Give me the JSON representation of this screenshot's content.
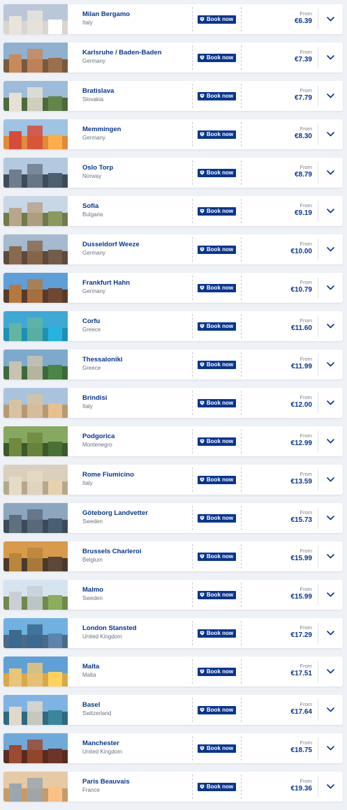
{
  "book_label": "Book now",
  "from_label": "From",
  "colors": {
    "brand": "#073590",
    "accent": "#f1c933",
    "card": "#ffffff",
    "background": "#eef1f6"
  },
  "destinations": [
    {
      "city": "Milan Bergamo",
      "country": "Italy",
      "price": "€6.39",
      "sky": "#b9c7d8",
      "ground": "#d9d6cf",
      "build": "#e8e4dc"
    },
    {
      "city": "Karlsruhe / Baden-Baden",
      "country": "Germany",
      "price": "€7.39",
      "sky": "#8fb0cf",
      "ground": "#7a5a3c",
      "build": "#c98a5a"
    },
    {
      "city": "Bratislava",
      "country": "Slovakia",
      "price": "€7.79",
      "sky": "#9dbcd9",
      "ground": "#4f6a3a",
      "build": "#e6e1d4"
    },
    {
      "city": "Memmingen",
      "country": "Germany",
      "price": "€8.30",
      "sky": "#9ec4e3",
      "ground": "#e08a3a",
      "build": "#d64b3a"
    },
    {
      "city": "Oslo Torp",
      "country": "Norway",
      "price": "€8.79",
      "sky": "#b3c9df",
      "ground": "#3c4c5a",
      "build": "#6e7e8e"
    },
    {
      "city": "Sofia",
      "country": "Bulgaria",
      "price": "€9.19",
      "sky": "#c7d7e6",
      "ground": "#6f7b4a",
      "build": "#b8a58a"
    },
    {
      "city": "Dusseldorf Weeze",
      "country": "Germany",
      "price": "€10.00",
      "sky": "#a5b9cf",
      "ground": "#5c4a3a",
      "build": "#8a6a4e"
    },
    {
      "city": "Frankfurt Hahn",
      "country": "Germany",
      "price": "€10.79",
      "sky": "#5f9fd9",
      "ground": "#5a3a28",
      "build": "#b5793f"
    },
    {
      "city": "Corfu",
      "country": "Greece",
      "price": "€11.60",
      "sky": "#3fa8d4",
      "ground": "#1f8fb3",
      "build": "#62b5a0"
    },
    {
      "city": "Thessaloniki",
      "country": "Greece",
      "price": "€11.99",
      "sky": "#7fa9cc",
      "ground": "#3d6a3a",
      "build": "#c9c2b0"
    },
    {
      "city": "Brindisi",
      "country": "Italy",
      "price": "€12.00",
      "sky": "#a9c3dc",
      "ground": "#b89a72",
      "build": "#d8c3a0"
    },
    {
      "city": "Podgorica",
      "country": "Montenegro",
      "price": "€12.99",
      "sky": "#87a860",
      "ground": "#3b5a2a",
      "build": "#6f8a3e"
    },
    {
      "city": "Rome Fiumicino",
      "country": "Italy",
      "price": "€13.59",
      "sky": "#d9d0bd",
      "ground": "#b8a88a",
      "build": "#e5dcc5"
    },
    {
      "city": "Göteborg Landvetter",
      "country": "Sweden",
      "price": "€15.73",
      "sky": "#8da6bf",
      "ground": "#3b4b5c",
      "build": "#5e6f7e"
    },
    {
      "city": "Brussels Charleroi",
      "country": "Belgium",
      "price": "€15.99",
      "sky": "#d99a4c",
      "ground": "#4a3a2c",
      "build": "#b8863c"
    },
    {
      "city": "Malmo",
      "country": "Sweden",
      "price": "€15.99",
      "sky": "#d6e4ef",
      "ground": "#6f8a4a",
      "build": "#c9cfd6"
    },
    {
      "city": "London Stansted",
      "country": "United Kingdom",
      "price": "€17.29",
      "sky": "#6fb1e0",
      "ground": "#4a6a8a",
      "build": "#3a6a8e"
    },
    {
      "city": "Malta",
      "country": "Malta",
      "price": "€17.51",
      "sky": "#5fa0d6",
      "ground": "#d9a84a",
      "build": "#e8c57a"
    },
    {
      "city": "Basel",
      "country": "Switzerland",
      "price": "€17.64",
      "sky": "#7fb3e3",
      "ground": "#2f6a7e",
      "build": "#e0d8c8"
    },
    {
      "city": "Manchester",
      "country": "United Kingdom",
      "price": "€18.75",
      "sky": "#6fa9d9",
      "ground": "#5a2a1e",
      "build": "#9c4a30"
    },
    {
      "city": "Paris Beauvais",
      "country": "France",
      "price": "€19.36",
      "sky": "#e6c9a5",
      "ground": "#c79a6a",
      "build": "#9aa7b0"
    }
  ]
}
